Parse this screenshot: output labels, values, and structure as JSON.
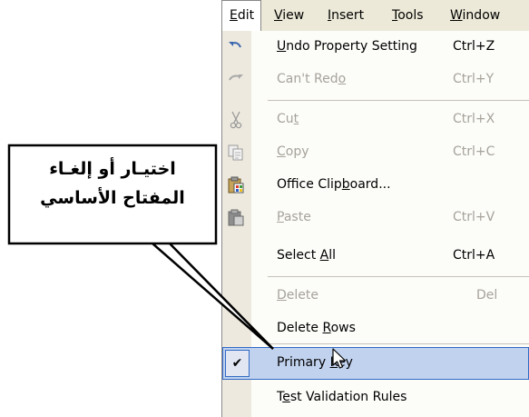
{
  "menubar": {
    "items": [
      {
        "label": "Edit",
        "access_index": 0
      },
      {
        "label": "View",
        "access_index": 0
      },
      {
        "label": "Insert",
        "access_index": 0
      },
      {
        "label": "Tools",
        "access_index": 0
      },
      {
        "label": "Window",
        "access_index": 0
      }
    ]
  },
  "menu": {
    "undo": {
      "pre": "",
      "acc": "U",
      "post": "ndo Property Setting",
      "shortcut": "Ctrl+Z"
    },
    "redo": {
      "pre": "Can't Red",
      "acc": "o",
      "post": "",
      "shortcut": "Ctrl+Y"
    },
    "cut": {
      "pre": "Cu",
      "acc": "t",
      "post": "",
      "shortcut": "Ctrl+X"
    },
    "copy": {
      "pre": "",
      "acc": "C",
      "post": "opy",
      "shortcut": "Ctrl+C"
    },
    "clipboard": {
      "pre": "Office Clip",
      "acc": "b",
      "post": "oard...",
      "shortcut": ""
    },
    "paste": {
      "pre": "",
      "acc": "P",
      "post": "aste",
      "shortcut": "Ctrl+V"
    },
    "select_all": {
      "pre": "Select ",
      "acc": "A",
      "post": "ll",
      "shortcut": "Ctrl+A"
    },
    "delete": {
      "pre": "",
      "acc": "D",
      "post": "elete",
      "shortcut": "Del"
    },
    "delete_rows": {
      "pre": "Delete ",
      "acc": "R",
      "post": "ows",
      "shortcut": ""
    },
    "primary_key": {
      "pre": "Primary ",
      "acc": "K",
      "post": "ey",
      "shortcut": "",
      "checked": true
    },
    "test_rules": {
      "pre": "T",
      "acc": "e",
      "post": "st Validation Rules",
      "shortcut": ""
    }
  },
  "callout": {
    "line1": "اختيـار أو إلغـاء",
    "line2": "المفتاح الأساسي"
  },
  "colors": {
    "menubar_bg": "#ece9d8",
    "gutter_bg": "#ede9de",
    "highlight_bg": "#c1d2ee",
    "highlight_border": "#316ac5",
    "disabled_text": "#a6a39a"
  },
  "icons": {
    "undo": "undo-icon",
    "redo": "redo-icon",
    "cut": "scissors-icon",
    "copy": "copy-icon",
    "clipboard": "office-clipboard-icon",
    "paste": "paste-icon",
    "primary_key": "checkmark-icon"
  }
}
